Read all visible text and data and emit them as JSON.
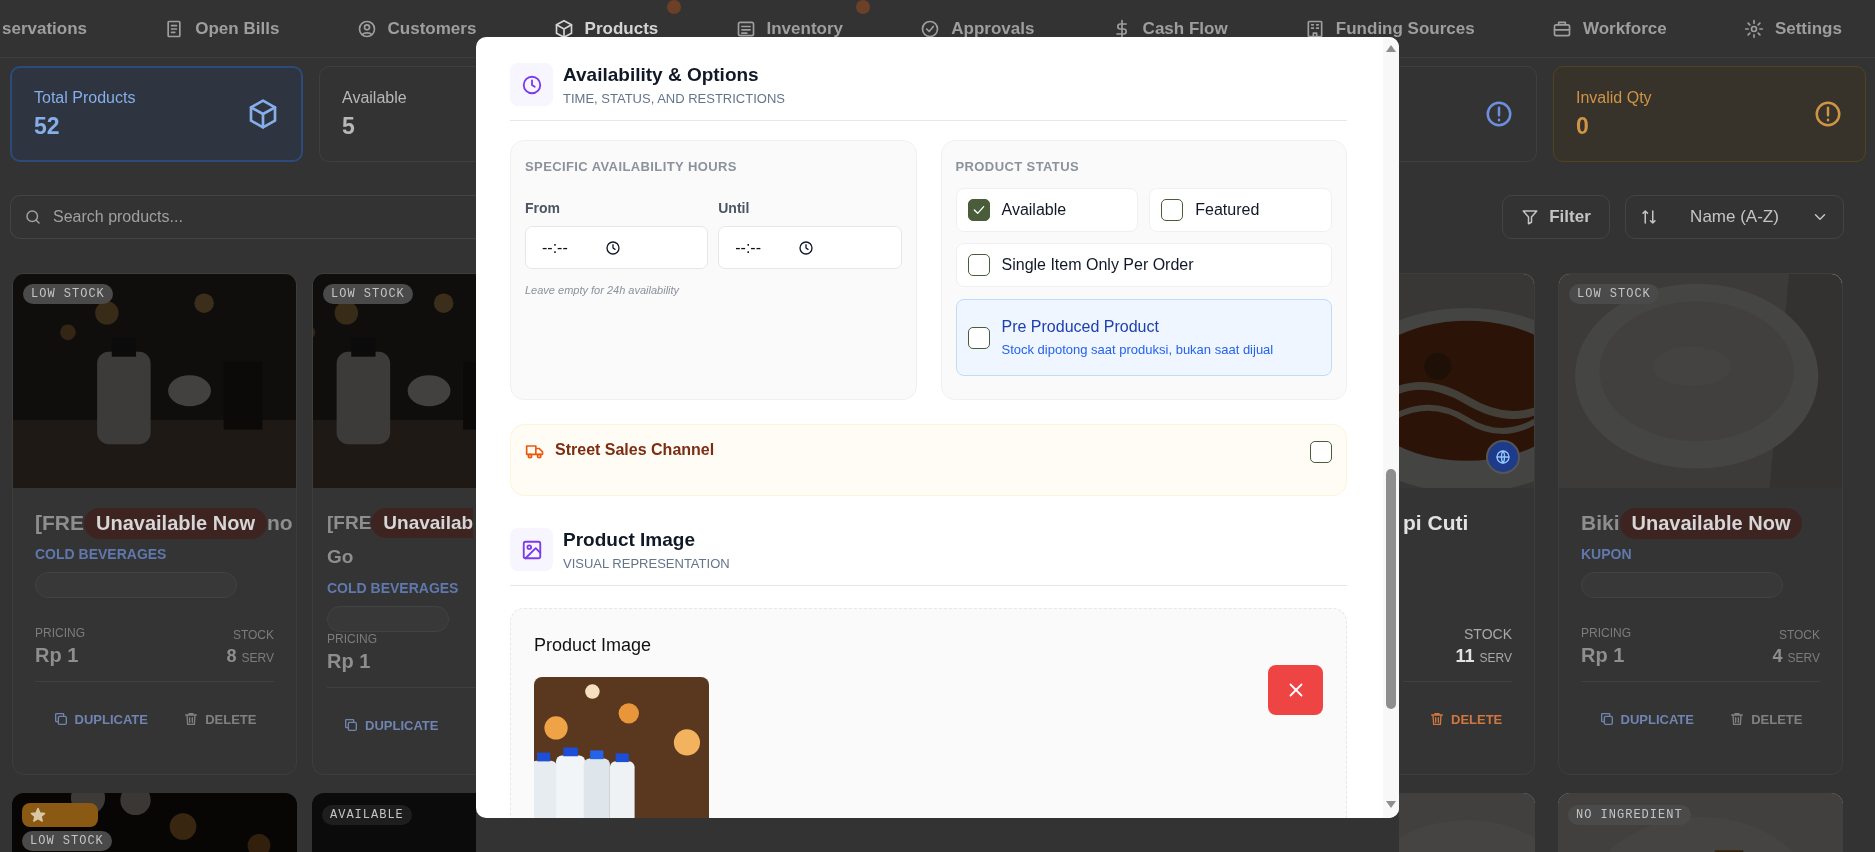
{
  "nav": {
    "items": [
      {
        "label": "servations",
        "selected": false
      },
      {
        "label": "Open Bills",
        "selected": false
      },
      {
        "label": "Customers",
        "selected": false
      },
      {
        "label": "Products",
        "selected": true
      },
      {
        "label": "Inventory",
        "selected": false
      },
      {
        "label": "Approvals",
        "selected": false
      },
      {
        "label": "Cash Flow",
        "selected": false
      },
      {
        "label": "Funding Sources",
        "selected": false
      },
      {
        "label": "Workforce",
        "selected": false
      },
      {
        "label": "Settings",
        "selected": false
      }
    ]
  },
  "stats": [
    {
      "label": "Total Products",
      "value": "52",
      "kind": "total",
      "selected": true
    },
    {
      "label": "Available",
      "value": "5",
      "kind": "plain",
      "selected": false
    },
    {
      "kind": "info",
      "selected": false
    },
    {
      "label": "Invalid Qty",
      "value": "0",
      "kind": "warning",
      "selected": false
    }
  ],
  "search": {
    "placeholder": "Search products..."
  },
  "filter_button": {
    "label": "Filter"
  },
  "sort": {
    "value": "Name (A-Z)"
  },
  "products": [
    {
      "kind": "full",
      "available": false,
      "badge": "LOW STOCK",
      "title_before": "[FRE",
      "status": "Unavailable Now",
      "title_after": "no",
      "category": "COLD BEVERAGES",
      "pricing_label": "PRICING",
      "price": "Rp 1",
      "stock_label": "STOCK",
      "stock": "8",
      "unit": "SERV",
      "actions": [
        {
          "label": "DUPLICATE",
          "kind": "duplicate"
        },
        {
          "label": "DELETE",
          "kind": "delete"
        }
      ]
    },
    {
      "kind": "left",
      "available": false,
      "badge": "LOW STOCK",
      "title_before": "[FRE",
      "status": "Unavailab",
      "title_line2": "Go",
      "category": "COLD BEVERAGES",
      "pricing_label": "PRICING",
      "price": "Rp 1",
      "actions": [
        {
          "label": "DUPLICATE",
          "kind": "duplicate"
        }
      ]
    },
    {
      "kind": "right",
      "available": true,
      "online": true,
      "title_before": "pi Cuti",
      "stock_label": "STOCK",
      "stock": "11",
      "unit": "SERV",
      "actions": [
        {
          "label": "DELETE",
          "kind": "delete"
        }
      ]
    },
    {
      "kind": "full",
      "available": false,
      "badge": "LOW STOCK",
      "title_before": "Biki",
      "status": "Unavailable Now",
      "category": "KUPON",
      "pricing_label": "PRICING",
      "price": "Rp 1",
      "stock_label": "STOCK",
      "stock": "4",
      "unit": "SERV",
      "actions": [
        {
          "label": "DUPLICATE",
          "kind": "duplicate"
        },
        {
          "label": "DELETE",
          "kind": "delete"
        }
      ]
    }
  ],
  "products_row2": [
    {
      "kind": "full",
      "featured": true,
      "badge": "LOW STOCK"
    },
    {
      "kind": "left",
      "badge": "AVAILABLE"
    },
    {
      "kind": "right"
    },
    {
      "kind": "full",
      "badge": "NO INGREDIENT"
    }
  ],
  "modal": {
    "availability": {
      "title": "Availability & Options",
      "subtitle": "TIME, STATUS, AND RESTRICTIONS",
      "hours": {
        "heading": "SPECIFIC AVAILABILITY HOURS",
        "fields": [
          {
            "label": "From",
            "placeholder": "--:--"
          },
          {
            "label": "Until",
            "placeholder": "--:--"
          }
        ],
        "hint": "Leave empty for 24h availability"
      },
      "status": {
        "heading": "PRODUCT STATUS",
        "options": [
          {
            "label": "Available",
            "checked": true,
            "kind": "half"
          },
          {
            "label": "Featured",
            "checked": false,
            "kind": "half"
          },
          {
            "label": "Single Item Only Per Order",
            "checked": false,
            "kind": "full"
          },
          {
            "label": "Pre Produced Product",
            "description": "Stock dipotong saat produksi, bukan saat dijual",
            "checked": false,
            "kind": "info"
          }
        ]
      }
    },
    "street_sales": {
      "label": "Street Sales Channel",
      "checked": false
    },
    "image_section": {
      "title": "Product Image",
      "subtitle": "VISUAL REPRESENTATION",
      "field_label": "Product Image"
    }
  }
}
